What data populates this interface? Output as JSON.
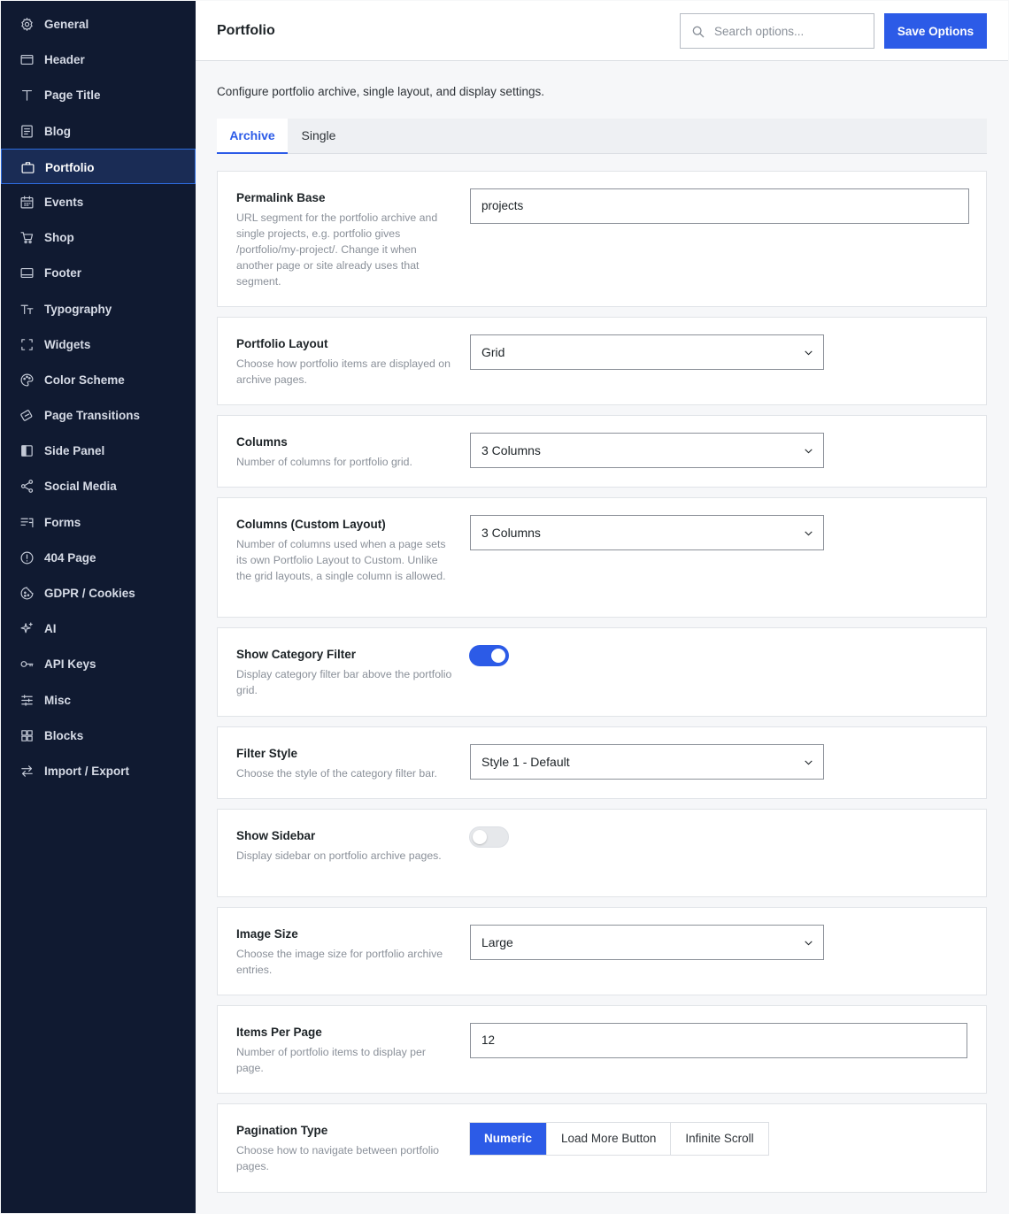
{
  "sidebar": {
    "items": [
      {
        "label": "General",
        "icon": "gear-icon"
      },
      {
        "label": "Header",
        "icon": "header-icon"
      },
      {
        "label": "Page Title",
        "icon": "title-icon"
      },
      {
        "label": "Blog",
        "icon": "blog-icon"
      },
      {
        "label": "Portfolio",
        "icon": "briefcase-icon",
        "active": true
      },
      {
        "label": "Events",
        "icon": "calendar-icon"
      },
      {
        "label": "Shop",
        "icon": "cart-icon"
      },
      {
        "label": "Footer",
        "icon": "footer-icon"
      },
      {
        "label": "Typography",
        "icon": "typography-icon"
      },
      {
        "label": "Widgets",
        "icon": "widgets-icon"
      },
      {
        "label": "Color Scheme",
        "icon": "palette-icon"
      },
      {
        "label": "Page Transitions",
        "icon": "transitions-icon"
      },
      {
        "label": "Side Panel",
        "icon": "side-panel-icon"
      },
      {
        "label": "Social Media",
        "icon": "share-icon"
      },
      {
        "label": "Forms",
        "icon": "forms-icon"
      },
      {
        "label": "404 Page",
        "icon": "alert-icon"
      },
      {
        "label": "GDPR / Cookies",
        "icon": "cookie-icon"
      },
      {
        "label": "AI",
        "icon": "sparkle-icon"
      },
      {
        "label": "API Keys",
        "icon": "key-icon"
      },
      {
        "label": "Misc",
        "icon": "sliders-icon"
      },
      {
        "label": "Blocks",
        "icon": "blocks-icon"
      },
      {
        "label": "Import / Export",
        "icon": "arrows-icon"
      }
    ]
  },
  "header": {
    "title": "Portfolio",
    "search_placeholder": "Search options...",
    "save_label": "Save Options"
  },
  "main": {
    "description": "Configure portfolio archive, single layout, and display settings.",
    "tabs": [
      {
        "label": "Archive",
        "active": true
      },
      {
        "label": "Single",
        "active": false
      }
    ],
    "settings": {
      "permalink": {
        "title": "Permalink Base",
        "desc": "URL segment for the portfolio archive and single projects, e.g. portfolio gives /portfolio/my-project/. Change it when another page or site already uses that segment.",
        "value": "projects"
      },
      "layout": {
        "title": "Portfolio Layout",
        "desc": "Choose how portfolio items are displayed on archive pages.",
        "value": "Grid"
      },
      "columns": {
        "title": "Columns",
        "desc": "Number of columns for portfolio grid.",
        "value": "3 Columns"
      },
      "columns_custom": {
        "title": "Columns (Custom Layout)",
        "desc": "Number of columns used when a page sets its own Portfolio Layout to Custom. Unlike the grid layouts, a single column is allowed.",
        "value": "3 Columns"
      },
      "category_filter": {
        "title": "Show Category Filter",
        "desc": "Display category filter bar above the portfolio grid.",
        "enabled": true
      },
      "filter_style": {
        "title": "Filter Style",
        "desc": "Choose the style of the category filter bar.",
        "value": "Style 1 - Default"
      },
      "sidebar": {
        "title": "Show Sidebar",
        "desc": "Display sidebar on portfolio archive pages.",
        "enabled": false
      },
      "image_size": {
        "title": "Image Size",
        "desc": "Choose the image size for portfolio archive entries.",
        "value": "Large"
      },
      "items_per_page": {
        "title": "Items Per Page",
        "desc": "Number of portfolio items to display per page.",
        "value": "12"
      },
      "pagination": {
        "title": "Pagination Type",
        "desc": "Choose how to navigate between portfolio pages.",
        "options": [
          {
            "label": "Numeric",
            "active": true
          },
          {
            "label": "Load More Button",
            "active": false
          },
          {
            "label": "Infinite Scroll",
            "active": false
          }
        ]
      }
    }
  },
  "colors": {
    "sidebar_bg": "#101a31",
    "accent": "#2c5be7",
    "active_nav_bg": "#1a2c55"
  }
}
